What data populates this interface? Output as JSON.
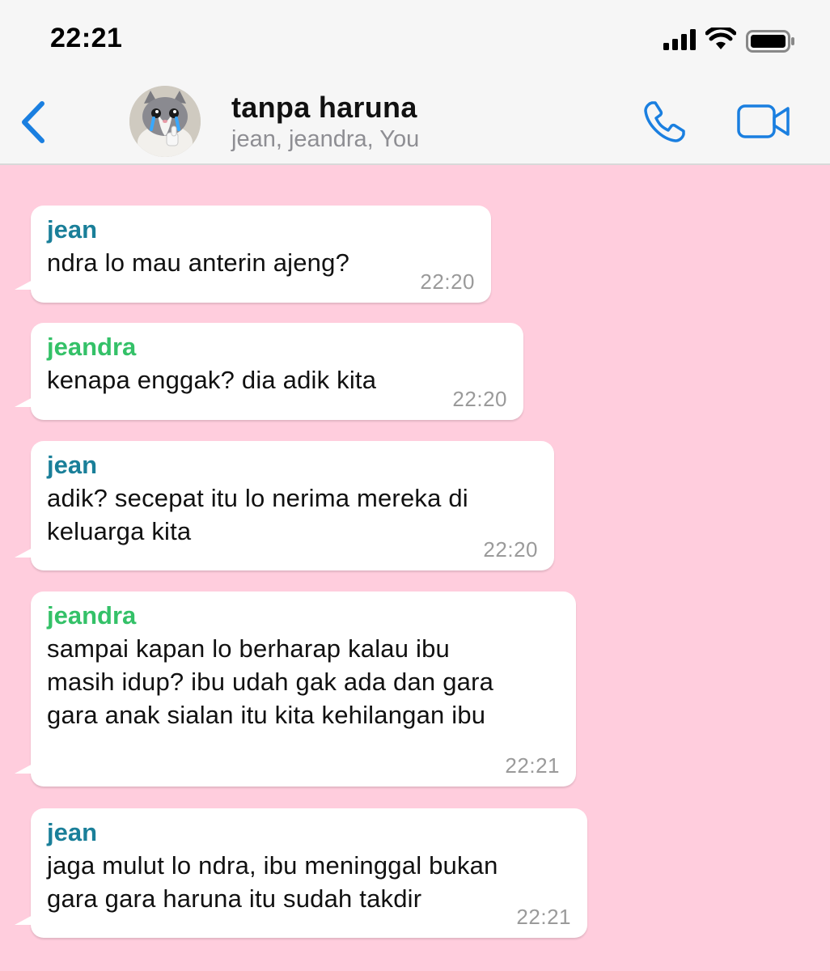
{
  "status_bar": {
    "time": "22:21",
    "icons": [
      "signal-icon",
      "wifi-icon",
      "battery-icon"
    ]
  },
  "header": {
    "back_icon": "back-chevron-icon",
    "title": "tanpa haruna",
    "members": "jean, jeandra, You",
    "call_icon": "phone-icon",
    "video_icon": "video-camera-icon"
  },
  "colors": {
    "chat_background": "#ffcddd",
    "accent": "#1a7fe0",
    "sender_jean": "#1a7f99",
    "sender_jeandra": "#34c168"
  },
  "messages": [
    {
      "sender": "jean",
      "text": "ndra lo mau anterin ajeng?",
      "time": "22:20"
    },
    {
      "sender": "jeandra",
      "text": "kenapa enggak? dia adik kita",
      "time": "22:20"
    },
    {
      "sender": "jean",
      "text": "adik? secepat itu lo nerima mereka di\nkeluarga kita",
      "time": "22:20"
    },
    {
      "sender": "jeandra",
      "text": "sampai kapan lo berharap kalau ibu\nmasih idup? ibu udah gak ada dan gara\ngara anak sialan itu kita kehilangan ibu",
      "time": "22:21"
    },
    {
      "sender": "jean",
      "text": "jaga mulut lo ndra, ibu meninggal bukan\ngara gara haruna itu sudah takdir",
      "time": "22:21"
    }
  ]
}
